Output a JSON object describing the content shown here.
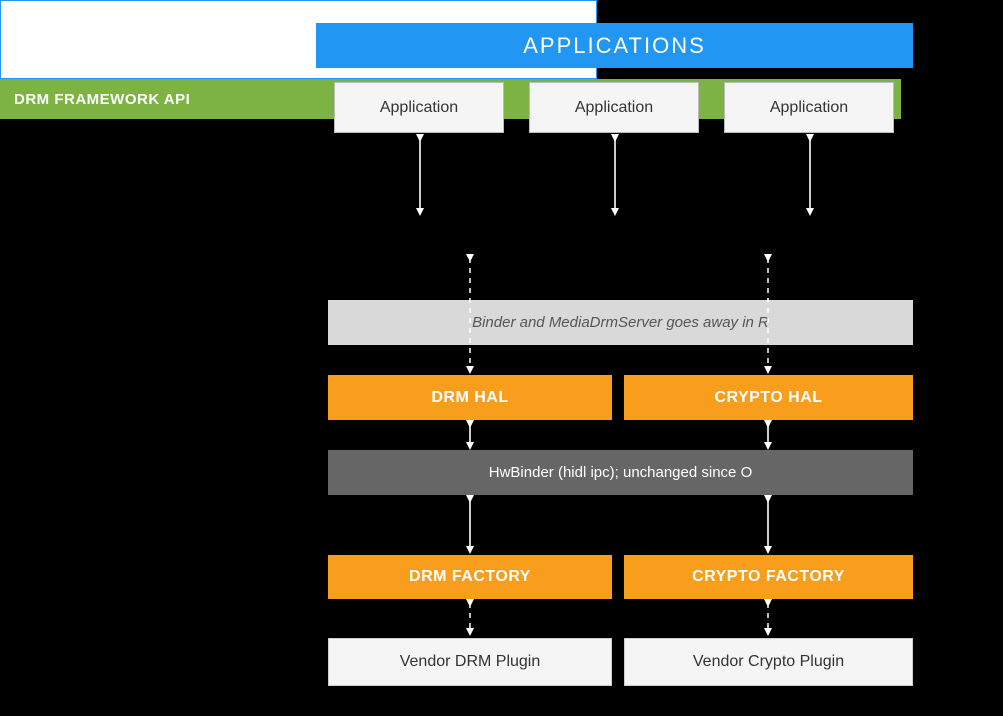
{
  "applications": {
    "title": "APPLICATIONS",
    "items": [
      "Application",
      "Application",
      "Application"
    ]
  },
  "drm_framework": {
    "label": "DRM FRAMEWORK API"
  },
  "binder_note": "Binder and MediaDrmServer  goes away in R",
  "hal": {
    "drm": "DRM HAL",
    "crypto": "CRYPTO HAL"
  },
  "hwbinder": "HwBinder (hidl ipc); unchanged since O",
  "factory": {
    "drm": "DRM FACTORY",
    "crypto": "CRYPTO FACTORY"
  },
  "vendor": {
    "drm": "Vendor DRM Plugin",
    "crypto": "Vendor Crypto Plugin"
  }
}
